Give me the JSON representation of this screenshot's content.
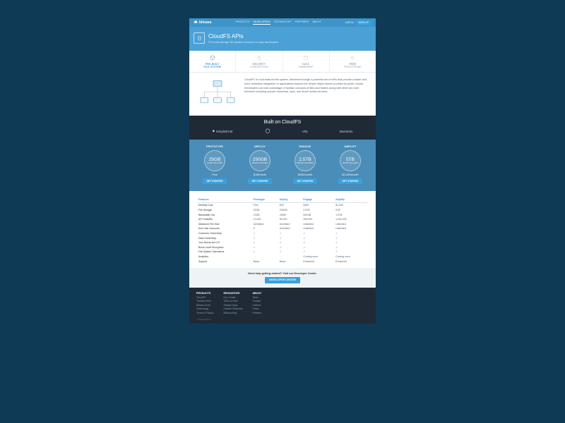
{
  "nav": {
    "brand": "bitcasa",
    "links": [
      "PRODUCTS",
      "DEVELOPERS",
      "TECHNOLOGY",
      "PARTNERS",
      "ABOUT"
    ],
    "active_index": 1,
    "login": "LOG IN",
    "signup": "SIGN UP"
  },
  "hero": {
    "title": "CloudFS APIs",
    "subtitle": "Pre-built storage file system services for app developers"
  },
  "features": [
    {
      "l1": "PRE-BUILT",
      "l2": "FILE SYSTEM"
    },
    {
      "l1": "SECURITY",
      "l2": "& ENCRYPTION"
    },
    {
      "l1": "DATA",
      "l2": "OWNERSHIP"
    },
    {
      "l1": "FREE",
      "l2": "PROTOTYPING"
    }
  ],
  "desc": "CloudFS is a full-featured file system, delivered through a powerful set of APIs that provide a faster and more seamless integration to applications beyond the simple object stores provided by public clouds. Developers can take advantage of familiar concepts of files and folders along with other pre-built functions including upload, download, sync, and share media services.",
  "built": {
    "heading": "Built on CloudFS",
    "logos": [
      "SimpleECM",
      "",
      "VIfy",
      "Moments"
    ]
  },
  "plans": [
    {
      "tier": "PROTOTYPE",
      "amt": "25GB",
      "sub": "1M API CALLS/MO",
      "price": "Free",
      "cta": "GET STARTED"
    },
    {
      "tier": "DEPLOY",
      "amt": "250GB",
      "sub": "5M API CALLS/MO",
      "price": "$15/month",
      "cta": "GET STARTED"
    },
    {
      "tier": "ENGAGE",
      "amt": "2.5TB",
      "sub": "50M API CALLS/MO",
      "price": "$150/month",
      "cta": "GET STARTED"
    },
    {
      "tier": "AMPLIFY",
      "amt": "5TB",
      "sub": "1B API CALLS/MO",
      "price": "$1,000/month",
      "cta": "GET STARTED"
    }
  ],
  "comparison": {
    "headers": [
      "Features",
      "Prototype",
      "Deploy",
      "Engage",
      "Amplify"
    ],
    "rows": [
      [
        "Monthly Cost",
        "Free",
        "$25",
        "$250",
        "$1,000"
      ],
      [
        "File Storage",
        "25GB",
        "250GB",
        "2.5TB",
        "5TB"
      ],
      [
        "Bandwidth Out",
        "10GB",
        "25GB",
        "500GB",
        "1.5TB"
      ],
      [
        "API Calls/Mo",
        "10,000",
        "50,000",
        "250,000",
        "1,000,000"
      ],
      [
        "Maximum File Size",
        "Unlimited",
        "Unlimited",
        "Unlimited",
        "Unlimited"
      ],
      [
        "End User Accounts",
        "5",
        "Unlimited",
        "Unlimited",
        "Unlimited"
      ],
      [
        "Customer Ownership",
        "✓",
        "✓",
        "✓",
        "✓"
      ],
      [
        "Data Ownership",
        "✓",
        "✓",
        "✓",
        "✓"
      ],
      [
        "Your Brand and UX",
        "✓",
        "✓",
        "✓",
        "✓"
      ],
      [
        "Block-Level Encryption",
        "✓",
        "✓",
        "✓",
        "✓"
      ],
      [
        "File System Operations",
        "✓",
        "✓",
        "✓",
        "✓"
      ],
      [
        "Analytics",
        "",
        "",
        "Coming soon",
        "Coming soon"
      ],
      [
        "Support",
        "Basic",
        "Basic",
        "Enhanced",
        "Enhanced"
      ]
    ]
  },
  "devcenter": {
    "text": "Need help getting started? Visit our Developer Center.",
    "button": "DEVELOPER CENTER"
  },
  "footer": {
    "cols": [
      {
        "h": "PRODUCTS",
        "items": [
          "CloudFS",
          "Turnkey Drive",
          "Bitcasa Drive",
          "Technology",
          "Terms & Privacy"
        ]
      },
      {
        "h": "RESOURCES",
        "items": [
          "Dev Center",
          "SDKs & Docs",
          "Sample Apps",
          "Feature Requests",
          "Bitcasa Blog"
        ]
      },
      {
        "h": "ABOUT",
        "items": [
          "Team",
          "Contact",
          "Careers",
          "Press",
          "Partners"
        ]
      }
    ],
    "copy": "© Bitcasa 2015"
  }
}
